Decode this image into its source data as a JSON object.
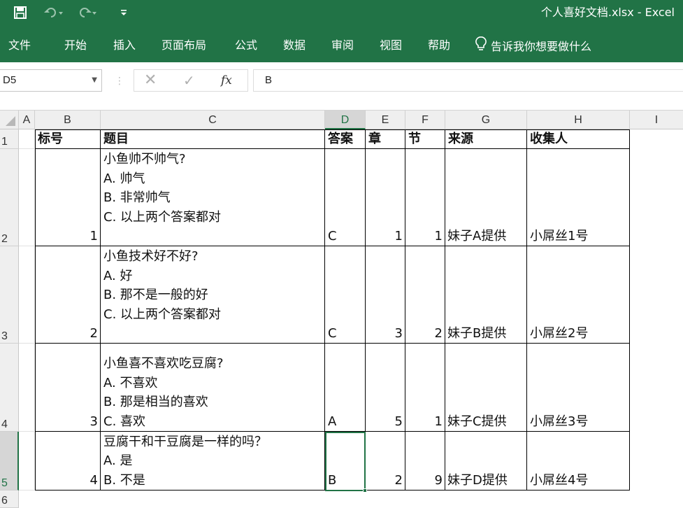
{
  "title_bar": {
    "title": "个人喜好文档.xlsx  -  Excel"
  },
  "ribbon": {
    "tabs": [
      "文件",
      "开始",
      "插入",
      "页面布局",
      "公式",
      "数据",
      "审阅",
      "视图",
      "帮助"
    ],
    "tell_me": "告诉我你想要做什么"
  },
  "formula_bar": {
    "name_box": "D5",
    "fx_label": "fx",
    "content": "B"
  },
  "columns": [
    "A",
    "B",
    "C",
    "D",
    "E",
    "F",
    "G",
    "H",
    "I"
  ],
  "rows": [
    "1",
    "2",
    "3",
    "4",
    "5",
    "6"
  ],
  "sheet": {
    "header": {
      "b": "标号",
      "c": "题目",
      "d": "答案",
      "e": "章",
      "f": "节",
      "g": "来源",
      "h": "收集人"
    },
    "records": [
      {
        "no": "1",
        "question": [
          "小鱼帅不帅气?",
          "A. 帅气",
          "B. 非常帅气",
          "C. 以上两个答案都对"
        ],
        "answer": "C",
        "chapter": "1",
        "section": "1",
        "source": "妹子A提供",
        "collector": "小屌丝1号"
      },
      {
        "no": "2",
        "question": [
          "小鱼技术好不好?",
          "A. 好",
          "B. 那不是一般的好",
          "C. 以上两个答案都对"
        ],
        "answer": "C",
        "chapter": "3",
        "section": "2",
        "source": "妹子B提供",
        "collector": "小屌丝2号"
      },
      {
        "no": "3",
        "question": [
          "小鱼喜不喜欢吃豆腐?",
          "A. 不喜欢",
          "B. 那是相当的喜欢",
          "C. 喜欢"
        ],
        "answer": "A",
        "chapter": "5",
        "section": "1",
        "source": "妹子C提供",
        "collector": "小屌丝3号"
      },
      {
        "no": "4",
        "question": [
          "豆腐干和干豆腐是一样的吗？",
          "A. 是",
          "B. 不是"
        ],
        "answer": "B",
        "chapter": "2",
        "section": "9",
        "source": "妹子D提供",
        "collector": "小屌丝4号"
      }
    ]
  },
  "colors": {
    "excel_green": "#217346",
    "header_bg": "#efefef",
    "selected_header_bg": "#d6d6d6"
  }
}
